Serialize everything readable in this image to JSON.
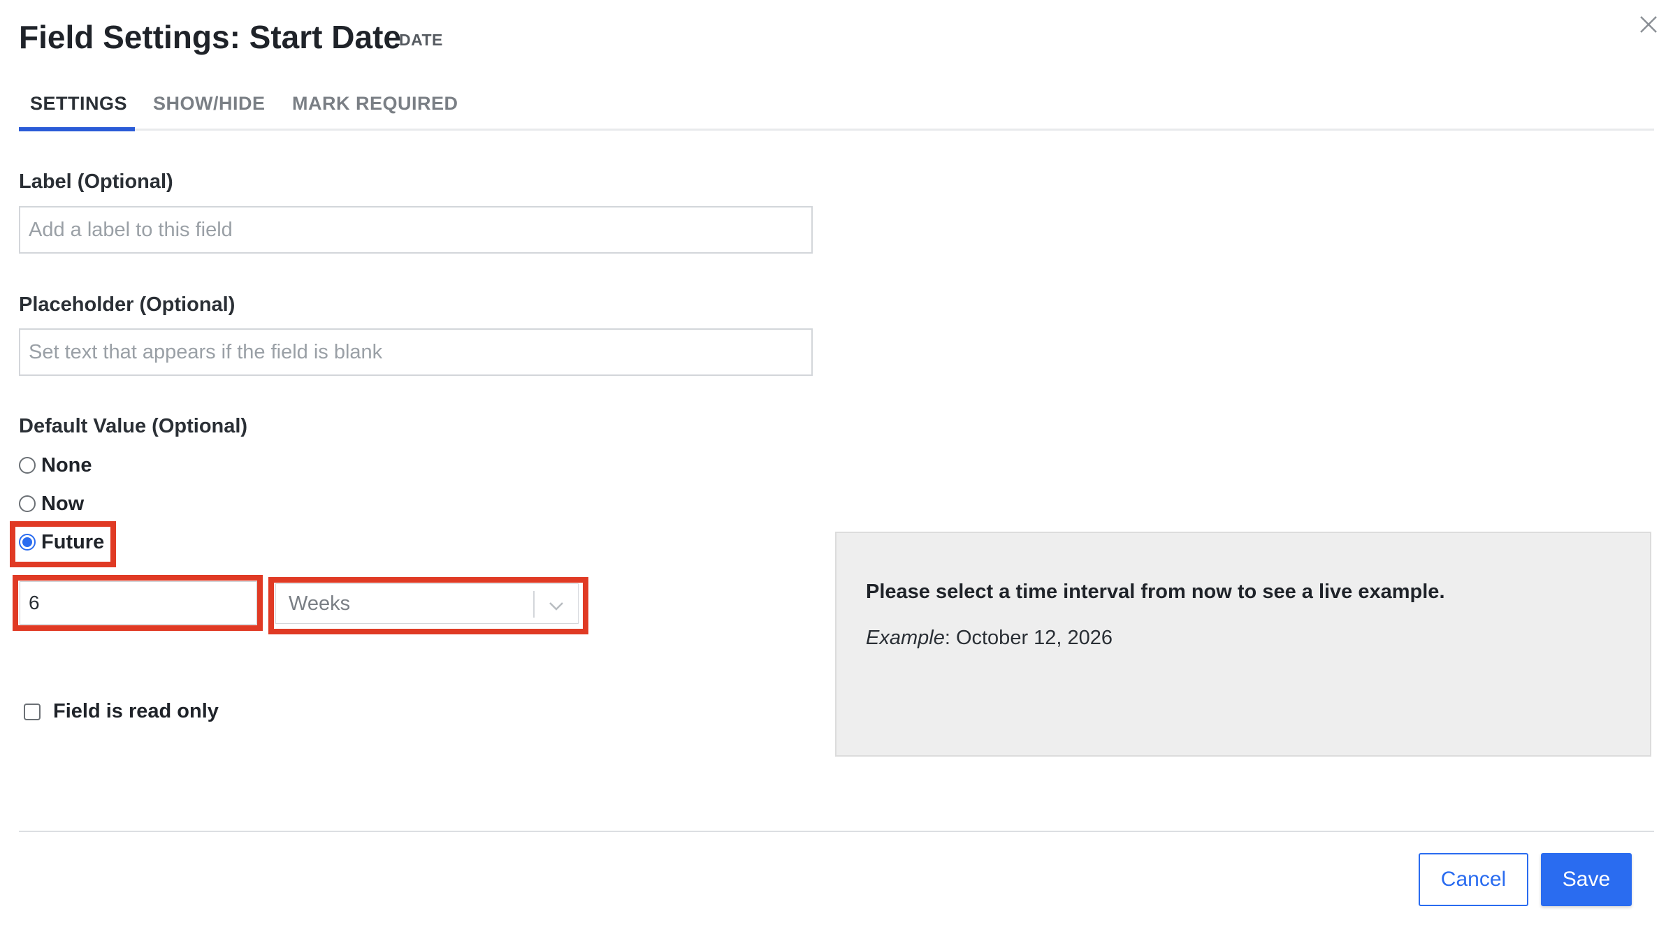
{
  "dialog": {
    "title": "Field Settings: Start Date",
    "type_badge": "DATE"
  },
  "tabs": [
    {
      "label": "SETTINGS",
      "active": true
    },
    {
      "label": "SHOW/HIDE",
      "active": false
    },
    {
      "label": "MARK REQUIRED",
      "active": false
    }
  ],
  "label_field": {
    "label": "Label (Optional)",
    "placeholder": "Add a label to this field",
    "value": ""
  },
  "placeholder_field": {
    "label": "Placeholder (Optional)",
    "placeholder": "Set text that appears if the field is blank",
    "value": ""
  },
  "default_value": {
    "label": "Default Value (Optional)",
    "options": [
      {
        "label": "None",
        "checked": false
      },
      {
        "label": "Now",
        "checked": false
      },
      {
        "label": "Future",
        "checked": true
      }
    ],
    "interval_amount": "6",
    "interval_unit": "Weeks"
  },
  "read_only": {
    "label": "Field is read only",
    "checked": false
  },
  "example_panel": {
    "heading": "Please select a time interval from now to see a live example.",
    "example_prefix": "Example",
    "example_value": ": October 12, 2026"
  },
  "footer": {
    "cancel_label": "Cancel",
    "save_label": "Save"
  },
  "colors": {
    "accent": "#2a6cf0",
    "highlight": "#e03a24",
    "panel_bg": "#eeeeee"
  },
  "icons": {
    "close": "close-icon",
    "dropdown": "chevron-down-icon"
  }
}
